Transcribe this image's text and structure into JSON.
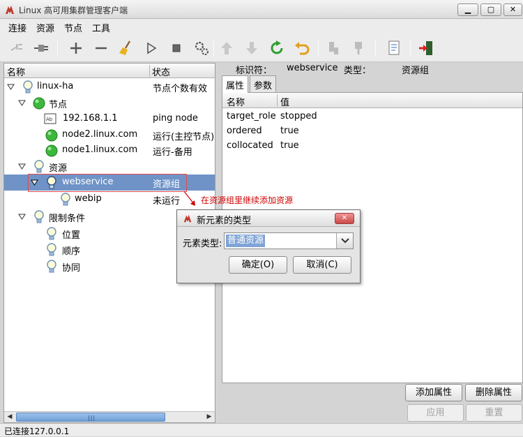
{
  "window": {
    "title": "Linux 高可用集群管理客户端"
  },
  "menu": [
    "连接",
    "资源",
    "节点",
    "工具"
  ],
  "toolbar": {
    "icons": [
      "plug-disconnected-icon",
      "plug-connect-icon",
      "plus-icon",
      "minus-icon",
      "broom-icon",
      "play-icon",
      "stop-icon",
      "gears-icon",
      "up-arrow-icon",
      "down-arrow-icon",
      "refresh-icon",
      "undo-icon",
      "node-standby-icon",
      "node-active-icon",
      "document-icon",
      "exit-icon"
    ]
  },
  "tree": {
    "headers": {
      "name": "名称",
      "status": "状态"
    },
    "rows": [
      {
        "name": "linux-ha",
        "status": "节点个数有效"
      },
      {
        "name": "节点",
        "status": ""
      },
      {
        "name": "192.168.1.1",
        "status": "ping node"
      },
      {
        "name": "node2.linux.com",
        "status": "运行(主控节点)"
      },
      {
        "name": "node1.linux.com",
        "status": "运行-备用"
      },
      {
        "name": "资源",
        "status": ""
      },
      {
        "name": "webservice",
        "status": "资源组"
      },
      {
        "name": "webip",
        "status": "未运行"
      },
      {
        "name": "限制条件",
        "status": ""
      },
      {
        "name": "位置",
        "status": ""
      },
      {
        "name": "顺序",
        "status": ""
      },
      {
        "name": "协同",
        "status": ""
      }
    ]
  },
  "detail": {
    "id_label": "标识符：",
    "id_value": "webservice",
    "type_label": "类型：",
    "type_value": "资源组",
    "tabs": [
      "属性",
      "参数"
    ],
    "grid_headers": {
      "name": "名称",
      "value": "值"
    },
    "attributes": [
      {
        "name": "target_role",
        "value": "stopped"
      },
      {
        "name": "ordered",
        "value": "true"
      },
      {
        "name": "collocated",
        "value": "true"
      }
    ],
    "buttons": {
      "add": "添加属性",
      "delete": "删除属性",
      "apply": "应用",
      "reset": "重置"
    }
  },
  "annotation": "在资源组里继续添加资源",
  "dialog": {
    "title": "新元素的类型",
    "label": "元素类型:",
    "selected": "普通资源",
    "ok": "确定(O)",
    "cancel": "取消(C)"
  },
  "status_bar": "已连接127.0.0.1",
  "colors": {
    "selection": "#6f93c7",
    "annotation": "#d00000",
    "scroll_thumb": "#6f9fd6"
  }
}
